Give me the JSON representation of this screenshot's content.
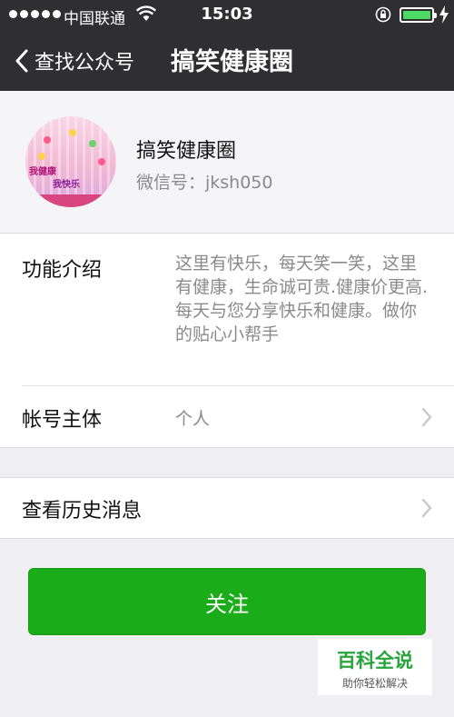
{
  "status_bar": {
    "carrier": "中国联通",
    "time": "15:03",
    "battery_color": "#4cd964"
  },
  "nav": {
    "back_label": "查找公众号",
    "title": "搞笑健康圈",
    "background": "#2f2f31"
  },
  "profile": {
    "avatar_text_1": "我健康",
    "avatar_text_2": "我快乐",
    "name": "搞笑健康圈",
    "wechat_id": "微信号：jksh050"
  },
  "info": {
    "intro_label": "功能介绍",
    "intro_text": "这里有快乐，每天笑一笑，这里有健康，生命诚可贵.健康价更高.每天与您分享快乐和健康。做你的贴心小帮手",
    "account_label": "帐号主体",
    "account_value": "个人"
  },
  "history": {
    "label": "查看历史消息"
  },
  "follow_button": {
    "label": "关注",
    "color": "#1aad19"
  },
  "watermark": {
    "main": "百科全说",
    "sub": "助你轻松解决"
  },
  "icons": [
    "signal-dots-icon",
    "wifi-icon",
    "orientation-lock-icon",
    "battery-icon",
    "charging-bolt-icon",
    "back-chevron-icon",
    "chevron-right-icon"
  ]
}
